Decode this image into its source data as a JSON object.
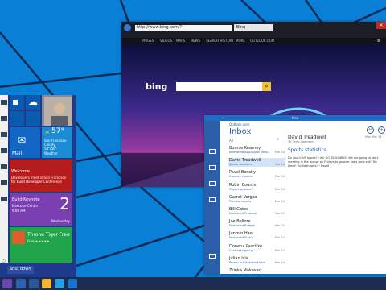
{
  "browser": {
    "address": "http://www.bing.com/?",
    "tab_title": "Bing",
    "close_glyph": "✕",
    "nav_links": [
      "IMAGES",
      "VIDEOS",
      "MAPS",
      "NEWS",
      "SEARCH HISTORY",
      "MORE",
      "OUTLOOK.COM"
    ],
    "logo_text": "bing"
  },
  "mail": {
    "title": "Mail",
    "account": "Outlook.com",
    "folder": "Inbox",
    "filter": "All",
    "messages": [
      {
        "from": "Bonnie Kearney",
        "subject": "Northwind Acquisition Deta...",
        "date": "Mar 24"
      },
      {
        "from": "David Treadwell",
        "subject": "Sports statistics",
        "date": "Mar 24"
      },
      {
        "from": "Pavel Bansky",
        "subject": "Expense reports",
        "date": "Mar 24"
      },
      {
        "from": "Robin Counts",
        "subject": "Project updates?",
        "date": "Mar 24"
      },
      {
        "from": "Garret Vargas",
        "subject": "Preview reports",
        "date": "Mar 24"
      },
      {
        "from": "Bill Gates",
        "subject": "Northwind Proposal",
        "date": "Mar 24"
      },
      {
        "from": "Joe Bellore",
        "subject": "Northwind Budget",
        "date": "Mar 24"
      },
      {
        "from": "Junmin Hao",
        "subject": "Northwind Status",
        "date": "Mar 24"
      },
      {
        "from": "Donena Paschke",
        "subject": "Contract signing",
        "date": "Mar 24"
      },
      {
        "from": "Julian Isla",
        "subject": "Person in Blacklisted Item",
        "date": "Mar 24"
      },
      {
        "from": "Zrinka Makovac",
        "subject": "",
        "date": ""
      }
    ],
    "reading": {
      "from": "David Treadwell",
      "to": "To: Terry Adamson",
      "date": "Mon Mar 24",
      "subject": "Sports statistics",
      "body": "Do you LOVE sports? I do! GO SEAHAWKS! We are going to start meeting in the lounge on Fridays to go over stats (and eat!) Be there! Go Seahawks! ~David"
    }
  },
  "start": {
    "tiles": {
      "mail": "Mail",
      "weather_temp": "57°",
      "weather_city": "San Francisco",
      "weather_desc": "Cloudy",
      "weather_range": "58°/50°",
      "weather_label": "Weather",
      "news_welcome": "Welcome",
      "news_text": "Developers meet in San Francisco for Build Developer Conference",
      "calendar_event": "Build Keynote",
      "calendar_place": "Moscone Center",
      "calendar_time": "9:00 AM",
      "calendar_day": "2",
      "calendar_weekday": "Wednesday",
      "store_title": "Throne Tiger Free",
      "store_sub": "Free ★★★★★"
    },
    "shutdown": "Shut down"
  },
  "colors": {
    "desktop": "#0a7fd6",
    "start": "#1e3a8a",
    "mail_accent": "#2a5ea8"
  }
}
